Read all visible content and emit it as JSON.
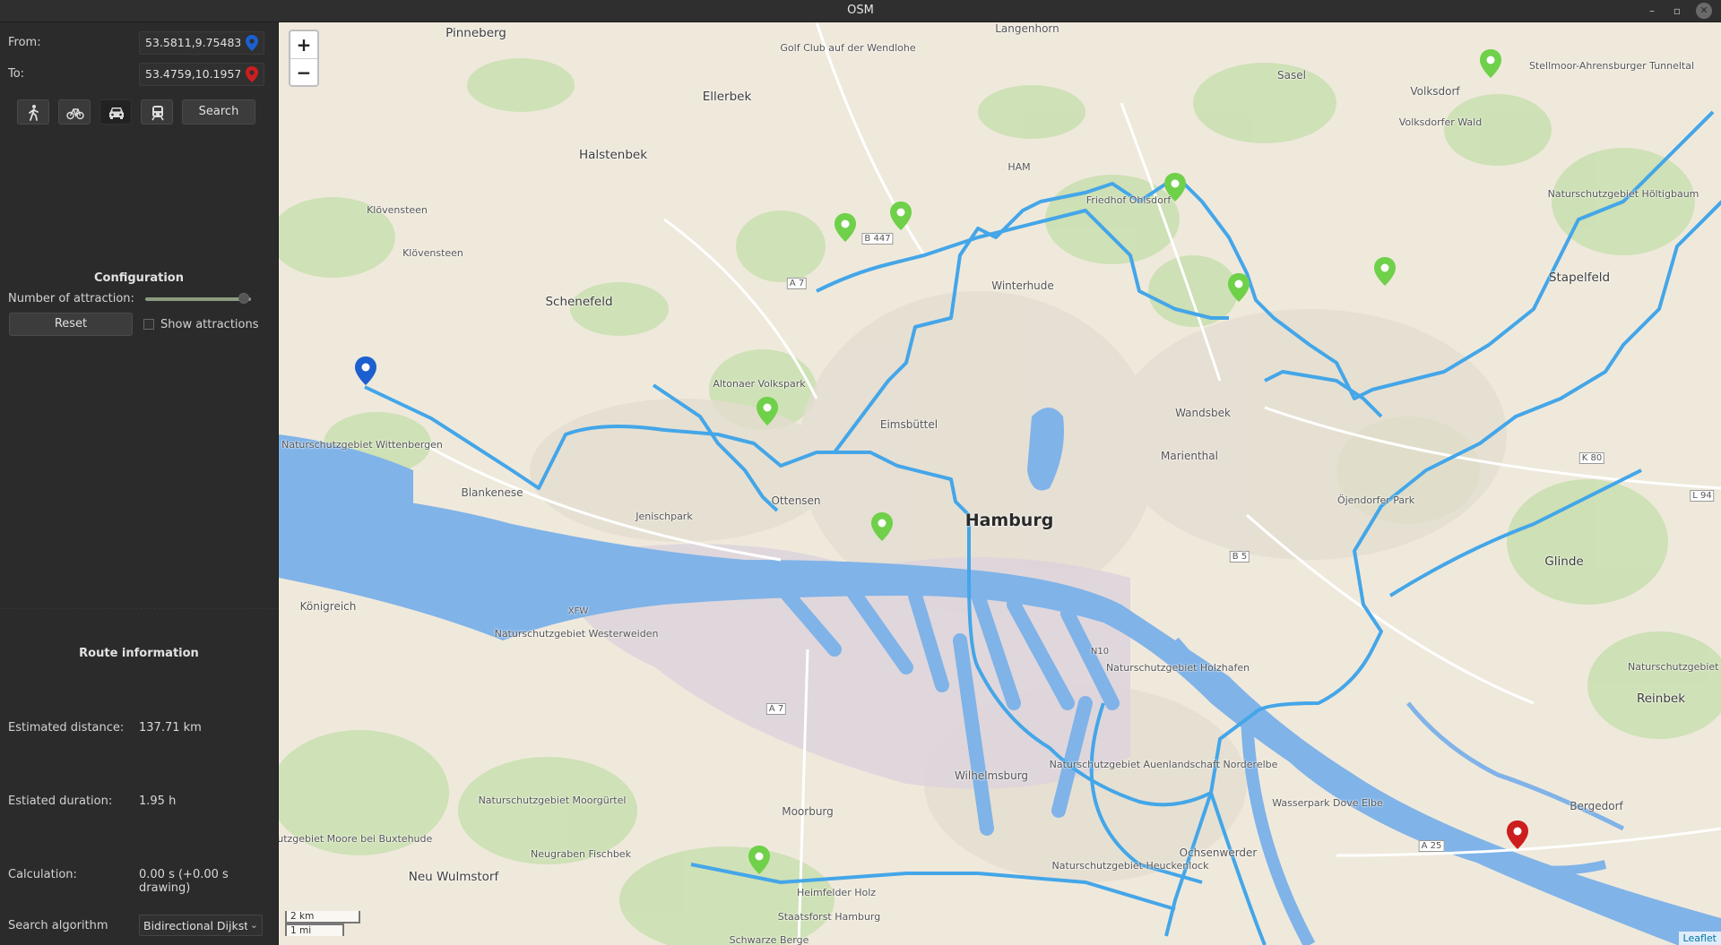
{
  "window": {
    "title": "OSM"
  },
  "sidebar": {
    "from_label": "From:",
    "from_value": "53.5811,9.75483",
    "to_label": "To:",
    "to_value": "53.4759,10.1957",
    "modes": [
      {
        "icon": "walk-icon",
        "active": false
      },
      {
        "icon": "bicycle-icon",
        "active": false
      },
      {
        "icon": "car-icon",
        "active": true
      },
      {
        "icon": "train-icon",
        "active": false
      }
    ],
    "search_label": "Search",
    "configuration_heading": "Configuration",
    "attractions_label": "Number of attraction:",
    "attractions_level": 0.93,
    "reset_label": "Reset",
    "show_attractions_label": "Show attractions",
    "show_attractions_checked": false,
    "route_heading": "Route information",
    "distance_label": "Estimated distance:",
    "distance_value": "137.71 km",
    "duration_label": "Estiated duration:",
    "duration_value": "1.95 h",
    "calc_label": "Calculation:",
    "calc_value": "0.00 s (+0.00 s drawing)",
    "algo_label": "Search algorithm",
    "algo_value": "Bidirectional Dijkstra"
  },
  "map": {
    "colors": {
      "water": "#80b3e8",
      "route": "#44a6e8",
      "start": "#1c5fcf",
      "end": "#cc1e1e",
      "attraction": "#6fd04a"
    },
    "zoom_in": "+",
    "zoom_out": "−",
    "scale_km": "2 km",
    "scale_mi": "1 mi",
    "attribution": "Leaflet",
    "places": {
      "pinneberg": "Pinneberg",
      "langenhorn": "Langenhorn",
      "ellerbek": "Ellerbek",
      "halstenbek": "Halstenbek",
      "sasel": "Sasel",
      "volksdorf": "Volksdorf",
      "stellmoor": "Stellmoor-Ahrensburger Tunneltal",
      "golf_club": "Golf Club auf der Wendlohe",
      "ham": "HAM",
      "friedhof": "Friedhof Ohlsdorf",
      "volksdorfer_wald": "Volksdorfer Wald",
      "klovensteen1": "Klövensteen",
      "klovensteen2": "Klövensteen",
      "schenefeld": "Schenefeld",
      "winterhude": "Winterhude",
      "stapelfeld": "Stapelfeld",
      "hoeltigbaum": "Naturschutzgebiet Höltigbaum",
      "altonaer_volkspark": "Altonaer Volkspark",
      "eimsbuettel": "Eimsbüttel",
      "wandsbek": "Wandsbek",
      "marienthal": "Marienthal",
      "wittenbergen": "Naturschutzgebiet Wittenbergen",
      "blankenese": "Blankenese",
      "jenischpark": "Jenischpark",
      "ottensen": "Ottensen",
      "hamburg": "Hamburg",
      "oejendorfer_park": "Öjendorfer Park",
      "glinde": "Glinde",
      "koenigreich": "Königreich",
      "xfw": "XFW",
      "westerweiden": "Naturschutzgebiet Westerweiden",
      "holzhafen": "Naturschutzgebiet Holzhafen",
      "reinbek": "Reinbek",
      "trittau": "Naturschutzgebiet Trittau",
      "auenlandschaft": "Naturschutzgebiet Auenlandschaft Norderelbe",
      "moorguertel": "Naturschutzgebiet Moorgürtel",
      "wilhelmsburg": "Wilhelmsburg",
      "moorburg": "Moorburg",
      "moore_buxtehude": "Naturschutzgebiet Moore bei Buxtehude",
      "wasserpark": "Wasserpark Dove Elbe",
      "bergedorf": "Bergedorf",
      "neugraben": "Neugraben Fischbek",
      "ochsenwerder": "Ochsenwerder",
      "heuckenlock": "Naturschutzgebiet Heuckenlock",
      "neu_wulmstorf": "Neu Wulmstorf",
      "heimfelder_holz": "Heimfelder Holz",
      "staatsforst": "Staatsforst Hamburg",
      "schwarze_berge": "Schwarze Berge"
    },
    "roads": {
      "a7_north": "A 7",
      "b447": "B 447",
      "a7_south": "A 7",
      "b5": "B 5",
      "k80": "K 80",
      "l94": "L 94",
      "a25": "A 25",
      "n10": "N10"
    }
  }
}
